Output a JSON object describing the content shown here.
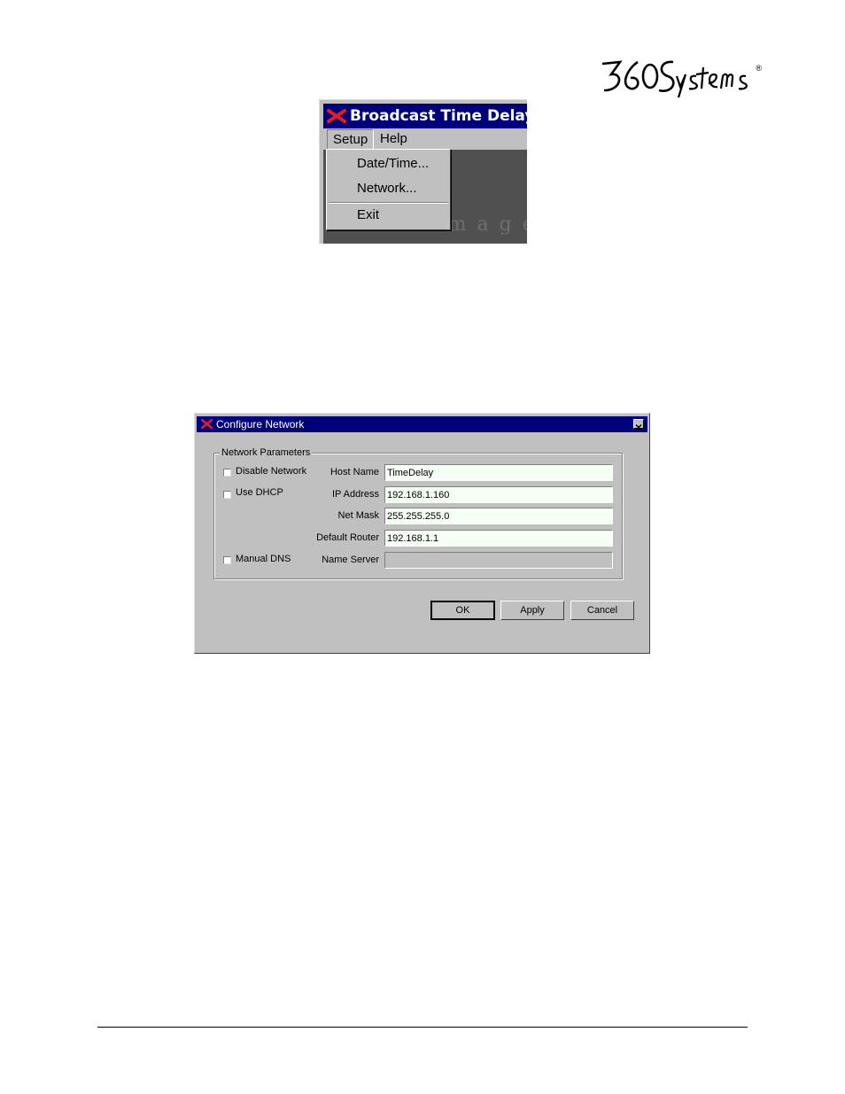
{
  "brand": {
    "logo_text": "360 Systems",
    "registered_mark": "®"
  },
  "app_window": {
    "title": "Broadcast Time Delay I",
    "menu": [
      "Setup",
      "Help"
    ],
    "dropdown": [
      "Date/Time...",
      "Network...",
      "Exit"
    ],
    "background_brand": "ImageServ"
  },
  "dialog": {
    "title": "Configure Network",
    "group_label": "Network Parameters",
    "checkboxes": {
      "disable_network": "Disable Network",
      "use_dhcp": "Use DHCP",
      "manual_dns": "Manual DNS"
    },
    "labels": {
      "host_name": "Host Name",
      "ip_address": "IP Address",
      "net_mask": "Net Mask",
      "default_router": "Default Router",
      "name_server": "Name Server"
    },
    "values": {
      "host_name": "TimeDelay",
      "ip_address": "192.168.1.160",
      "net_mask": "255.255.255.0",
      "default_router": "192.168.1.1",
      "name_server": ""
    },
    "buttons": {
      "ok": "OK",
      "apply": "Apply",
      "cancel": "Cancel"
    }
  }
}
